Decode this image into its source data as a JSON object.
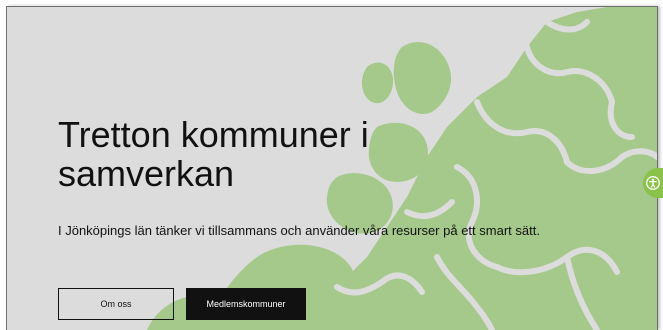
{
  "hero": {
    "title": "Tretton kommuner i samverkan",
    "lead": "I Jönköpings län tänker vi tillsammans och använder våra resurser på ett smart sätt."
  },
  "buttons": {
    "about": "Om oss",
    "members": "Medlemskommuner"
  },
  "accessibility_widget": {
    "icon": "accessibility-icon"
  },
  "colors": {
    "background": "#dcdcdc",
    "map_fill": "#a5c98b",
    "text": "#111111",
    "primary_button": "#111111",
    "accessibility_tab": "#8bc34a"
  }
}
